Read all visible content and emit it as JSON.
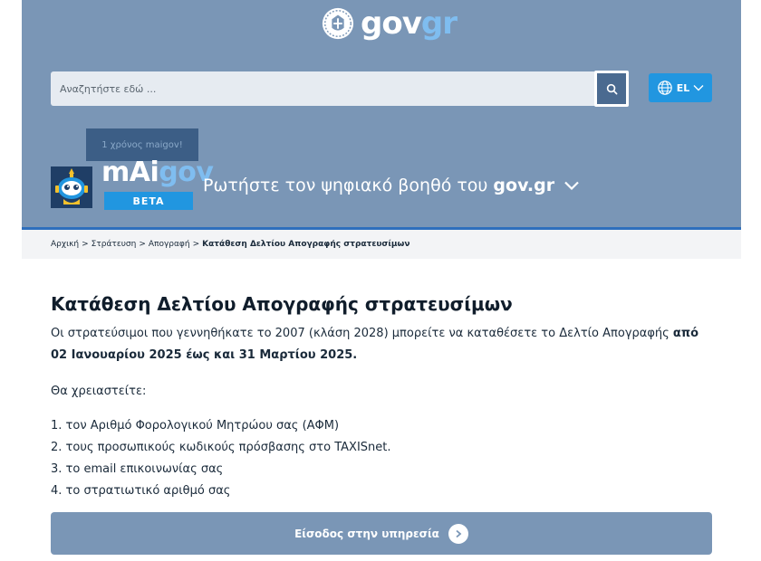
{
  "header": {
    "logo": {
      "part1": "gov",
      "part2": "gr"
    },
    "search": {
      "placeholder": "Αναζητήστε εδώ ..."
    },
    "language": {
      "code": "EL"
    }
  },
  "assistant": {
    "anniversary": "1 χρόνος maigov!",
    "name_part1": "mAi",
    "name_part2": "gov",
    "beta": "BETA",
    "prompt": "Ρωτήστε τον ψηφιακό βοηθό του",
    "prompt_bold": "gov.gr"
  },
  "breadcrumb": {
    "items": [
      "Αρχική",
      "Στράτευση",
      "Απογραφή"
    ],
    "current": "Κατάθεση Δελτίου Απογραφής στρατευσίμων",
    "separator": ">"
  },
  "main": {
    "title": "Κατάθεση Δελτίου Απογραφής στρατευσίμων",
    "intro": "Οι στρατεύσιμοι που γεννηθήκατε το 2007 (κλάση 2028) μπορείτε να καταθέσετε το Δελτίο Απογραφής ",
    "intro_bold": "από 02 Ιανουαρίου 2025 έως και 31 Μαρτίου 2025.",
    "need_label": "Θα χρειαστείτε:",
    "requirements": [
      "1. τον Αριθμό Φορολογικού Μητρώου σας (ΑΦΜ)",
      "2. τους προσωπικούς κωδικούς πρόσβασης στο TAXISnet.",
      "3. το email επικοινωνίας σας",
      "4. το στρατιωτικό αριθμό σας"
    ],
    "enter_button": "Είσοδος στην υπηρεσία"
  }
}
